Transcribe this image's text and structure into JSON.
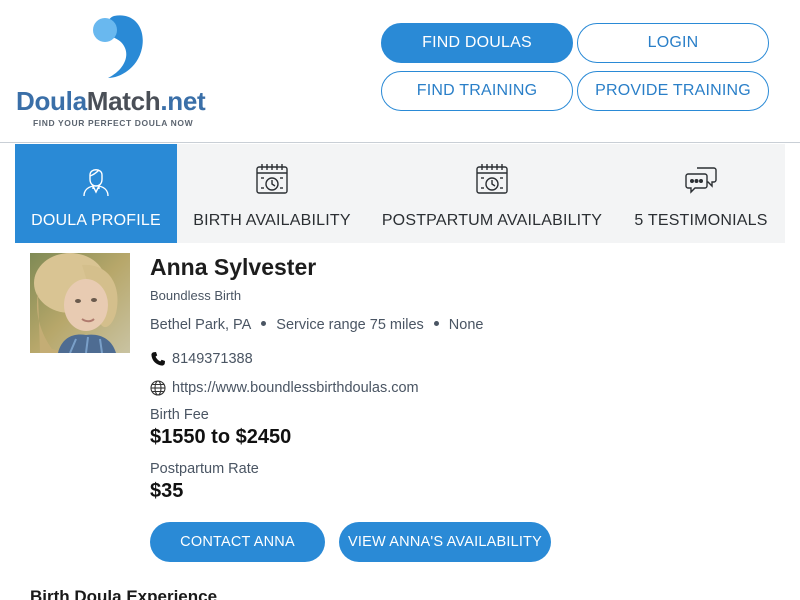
{
  "header": {
    "logo": {
      "name_part1": "Doula",
      "name_part2": "Match",
      "name_part3": ".net",
      "tagline": "FIND YOUR PERFECT DOULA NOW"
    },
    "nav": {
      "find_doulas": "FIND DOULAS",
      "login": "LOGIN",
      "find_training": "FIND TRAINING",
      "provide_training": "PROVIDE TRAINING"
    }
  },
  "tabs": [
    {
      "label": "DOULA PROFILE",
      "icon": "doula-avatar-icon",
      "active": true
    },
    {
      "label": "BIRTH AVAILABILITY",
      "icon": "calendar-clock-icon",
      "active": false
    },
    {
      "label": "POSTPARTUM AVAILABILITY",
      "icon": "calendar-clock-icon",
      "active": false
    },
    {
      "label": "5 TESTIMONIALS",
      "icon": "chat-bubbles-icon",
      "active": false
    }
  ],
  "profile": {
    "name": "Anna Sylvester",
    "organization": "Boundless Birth",
    "location": "Bethel Park, PA",
    "service_range": "Service range 75 miles",
    "extra": "None",
    "phone": "8149371388",
    "website": "https://www.boundlessbirthdoulas.com",
    "birth_fee_label": "Birth Fee",
    "birth_fee_value": "$1550 to $2450",
    "postpartum_rate_label": "Postpartum Rate",
    "postpartum_rate_value": "$35"
  },
  "actions": {
    "contact": "CONTACT ANNA",
    "availability": "VIEW ANNA'S AVAILABILITY"
  },
  "sections": {
    "experience_heading": "Birth Doula Experience"
  },
  "colors": {
    "accent": "#2a8ad6",
    "tab_background": "#f3f4f5",
    "text_muted": "#4a5563"
  }
}
